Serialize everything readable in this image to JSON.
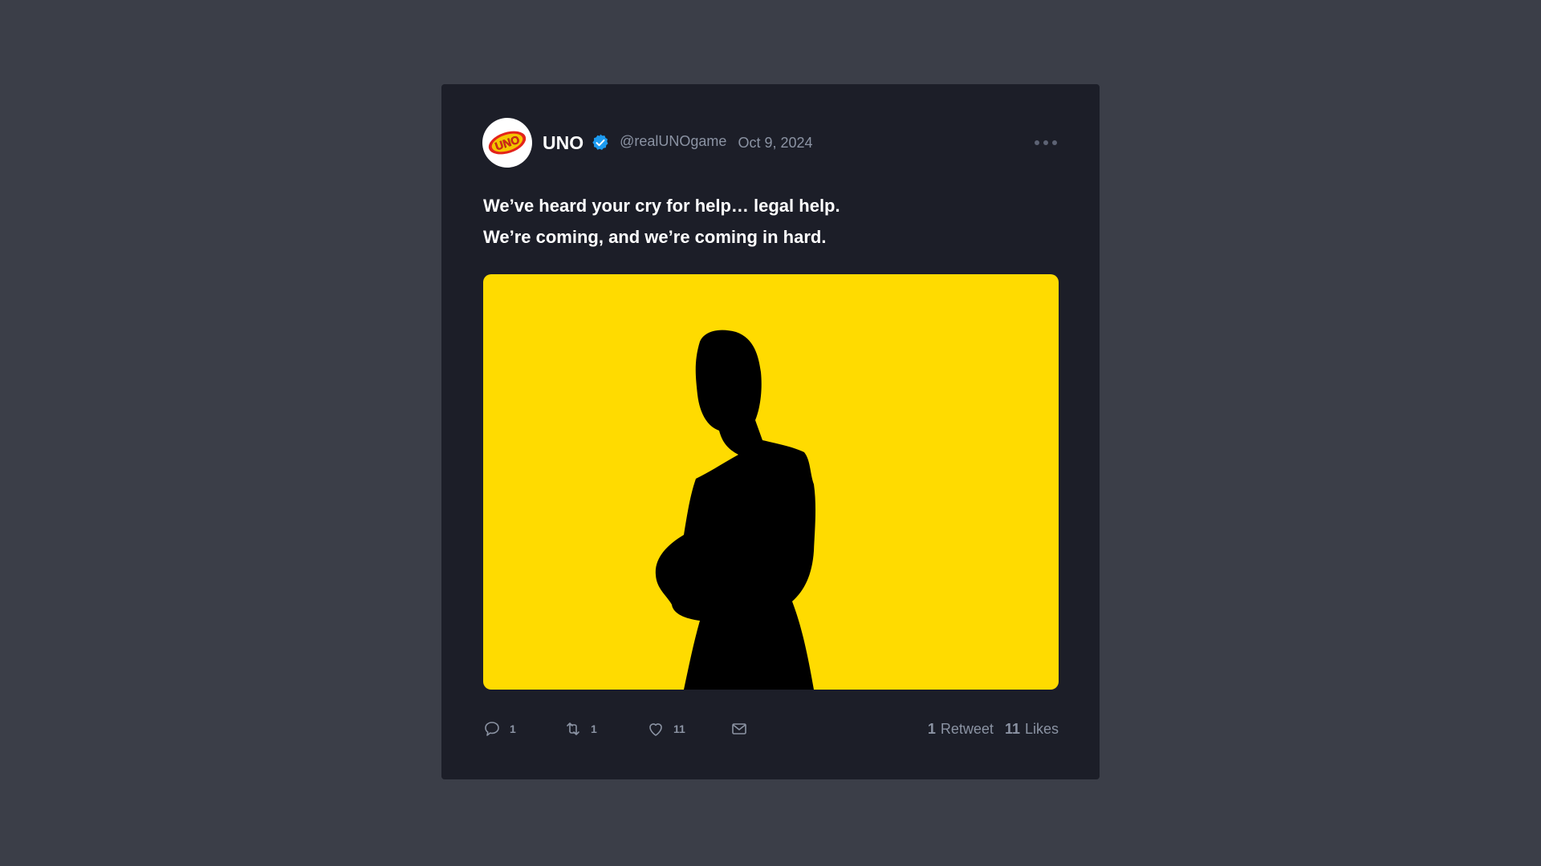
{
  "tweet": {
    "display_name": "UNO",
    "handle": "@realUNOgame",
    "date": "Oct 9, 2024",
    "verified": true,
    "avatar_logo_text": "UNO",
    "text_lines": [
      "We’ve heard your cry for help… legal help.",
      "We’re coming, and we’re coming in hard."
    ],
    "media": {
      "background_color": "#ffdb00",
      "subject": "black silhouette of a person with arms crossed"
    },
    "actions": {
      "reply_count": "1",
      "retweet_count": "1",
      "like_count": "11"
    },
    "stats": {
      "retweets_value": "1",
      "retweets_label": "Retweet",
      "likes_value": "11",
      "likes_label": "Likes"
    }
  },
  "icons": [
    "reply-icon",
    "retweet-icon",
    "heart-icon",
    "mail-icon",
    "verified-badge-icon",
    "more-icon"
  ],
  "colors": {
    "page_background": "#3b3e48",
    "card_background": "#1c1e28",
    "verified_blue": "#1d9bf0",
    "muted_text": "#8b93a3"
  }
}
